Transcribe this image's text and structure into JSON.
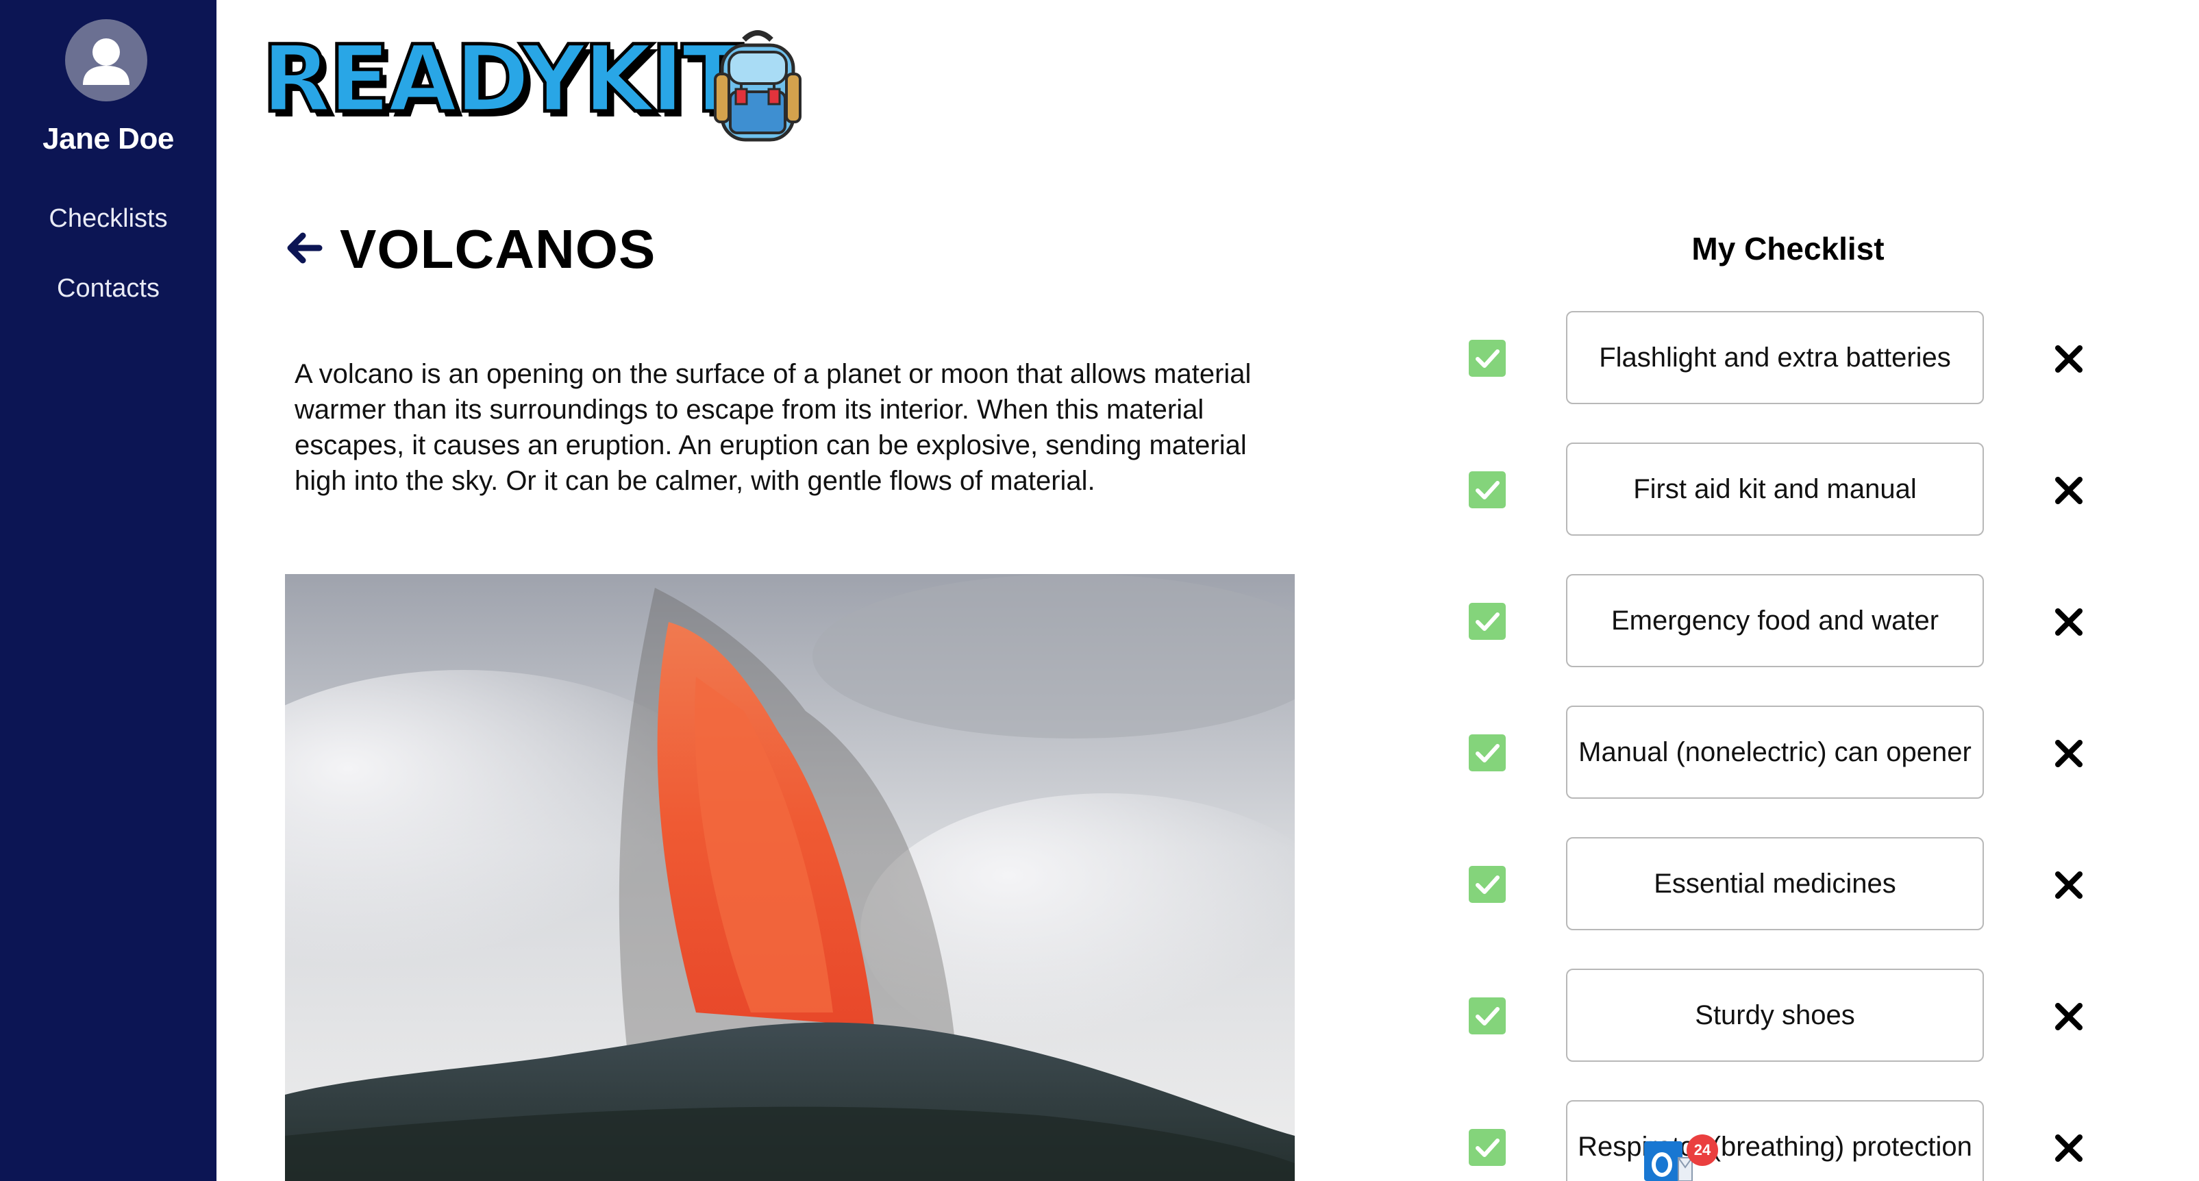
{
  "sidebar": {
    "user_name": "Jane Doe",
    "nav": [
      {
        "label": "Checklists"
      },
      {
        "label": "Contacts"
      }
    ]
  },
  "header": {
    "logo_text": "READYKIT"
  },
  "page": {
    "title": "VOLCANOS",
    "description": "A volcano is an opening on the surface of a planet or moon that allows material warmer than its surroundings to escape from its interior. When this material escapes, it causes an eruption. An eruption can be explosive, sending material high into the sky. Or it can be calmer, with gentle flows of material."
  },
  "checklist": {
    "title": "My Checklist",
    "items": [
      {
        "label": "Flashlight and extra batteries",
        "checked": true
      },
      {
        "label": "First aid kit and manual",
        "checked": true
      },
      {
        "label": "Emergency food and water",
        "checked": true
      },
      {
        "label": "Manual (nonelectric) can opener",
        "checked": true
      },
      {
        "label": "Essential medicines",
        "checked": true
      },
      {
        "label": "Sturdy shoes",
        "checked": true
      },
      {
        "label": "Respirator (breathing) protection",
        "checked": true
      }
    ]
  },
  "notification": {
    "badge_count": "24"
  },
  "colors": {
    "sidebar_bg": "#0c1554",
    "check_green": "#84d47b",
    "logo_blue": "#29a6e6"
  },
  "icons": {
    "avatar": "user-silhouette-icon",
    "back": "arrow-left-icon",
    "check": "checkmark-icon",
    "remove": "close-x-icon",
    "logo": "backpack-icon",
    "dock": "outlook-icon"
  }
}
